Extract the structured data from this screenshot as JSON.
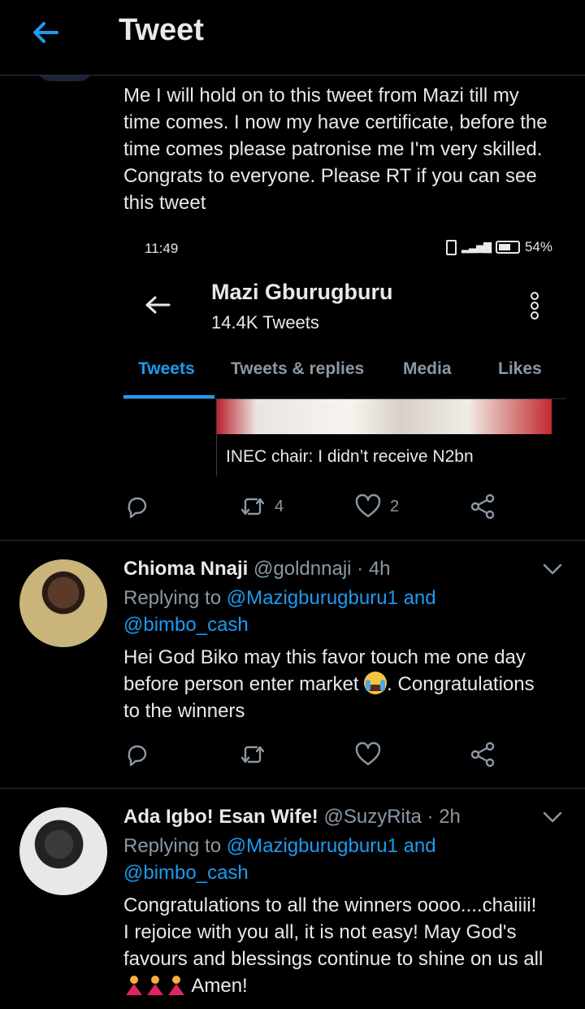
{
  "header": {
    "title": "Tweet"
  },
  "main_tweet": {
    "text_lines": [
      "Me I will hold on to this tweet from Mazi till my",
      "time comes. I now my have certificate, before the",
      "time comes please patronise me I'm very skilled.",
      "Congrats to everyone. Please RT if you can see",
      "this tweet"
    ],
    "embed": {
      "time": "11:49",
      "battery": "54%",
      "profile_name": "Mazi Gburugburu",
      "tweet_count": "14.4K Tweets",
      "tabs": [
        "Tweets",
        "Tweets & replies",
        "Media",
        "Likes"
      ],
      "active_tab": "Tweets",
      "card_caption": "INEC chair: I didn’t receive N2bn"
    },
    "retweets": "4",
    "likes": "2"
  },
  "replies": [
    {
      "name": "Chioma Nnaji",
      "handle": "@goldnnaji",
      "time": "· 4h",
      "replying_prefix": "Replying to",
      "replying_link1": "@Mazigburugburu1",
      "replying_and": "and",
      "replying_link2": "@bimbo_cash",
      "text_line1": "Hei God Biko may this favor touch me one day",
      "text_line2_a": "before person enter market",
      "text_line2_b": ". Congratulations",
      "text_line3": "to the winners"
    },
    {
      "name": "Ada Igbo! Esan Wife!",
      "handle": "@SuzyRita",
      "time": "· 2h",
      "replying_prefix": "Replying to",
      "replying_link1": "@Mazigburugburu1",
      "replying_and": "and",
      "replying_link2": "@bimbo_cash",
      "text_line1": "Congratulations to all the winners oooo....chaiiii!",
      "text_line2": "I rejoice with you all, it is not easy! May God's",
      "text_line3": "favours and blessings continue to shine on us all",
      "text_line4": "Amen!"
    }
  ]
}
